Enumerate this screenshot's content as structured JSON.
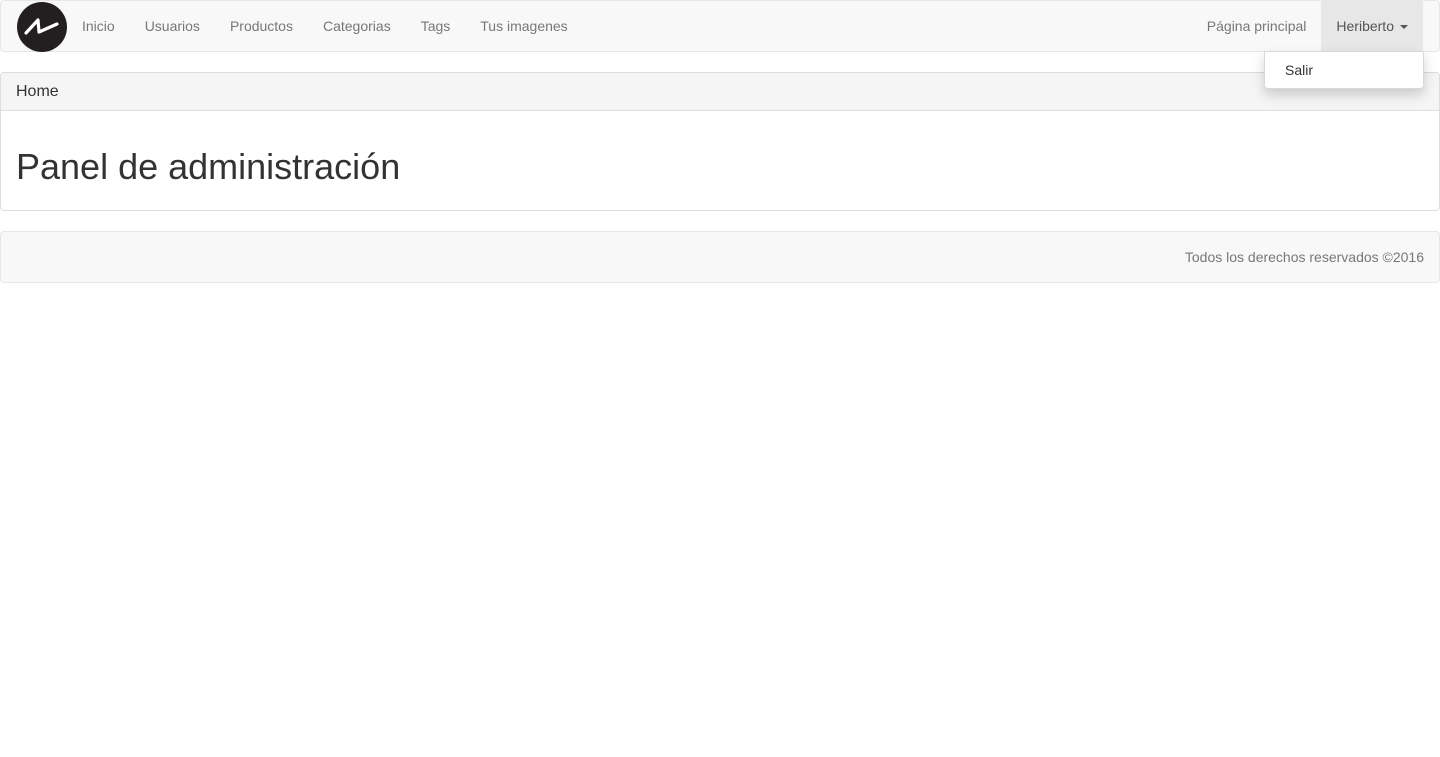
{
  "navbar": {
    "brand_icon": "brand-logo-icon",
    "left_items": [
      {
        "label": "Inicio"
      },
      {
        "label": "Usuarios"
      },
      {
        "label": "Productos"
      },
      {
        "label": "Categorias"
      },
      {
        "label": "Tags"
      },
      {
        "label": "Tus imagenes"
      }
    ],
    "right_items": {
      "home_link": "Página principal",
      "user_menu": "Heriberto"
    }
  },
  "dropdown": {
    "items": [
      {
        "label": "Salir"
      }
    ]
  },
  "panel": {
    "heading": "Home",
    "title": "Panel de administración"
  },
  "footer": {
    "text": "Todos los derechos reservados ©2016"
  },
  "colors": {
    "navbar_bg": "#f8f8f8",
    "nav_text": "#777777",
    "active_bg": "#e7e7e7",
    "text": "#333333"
  }
}
